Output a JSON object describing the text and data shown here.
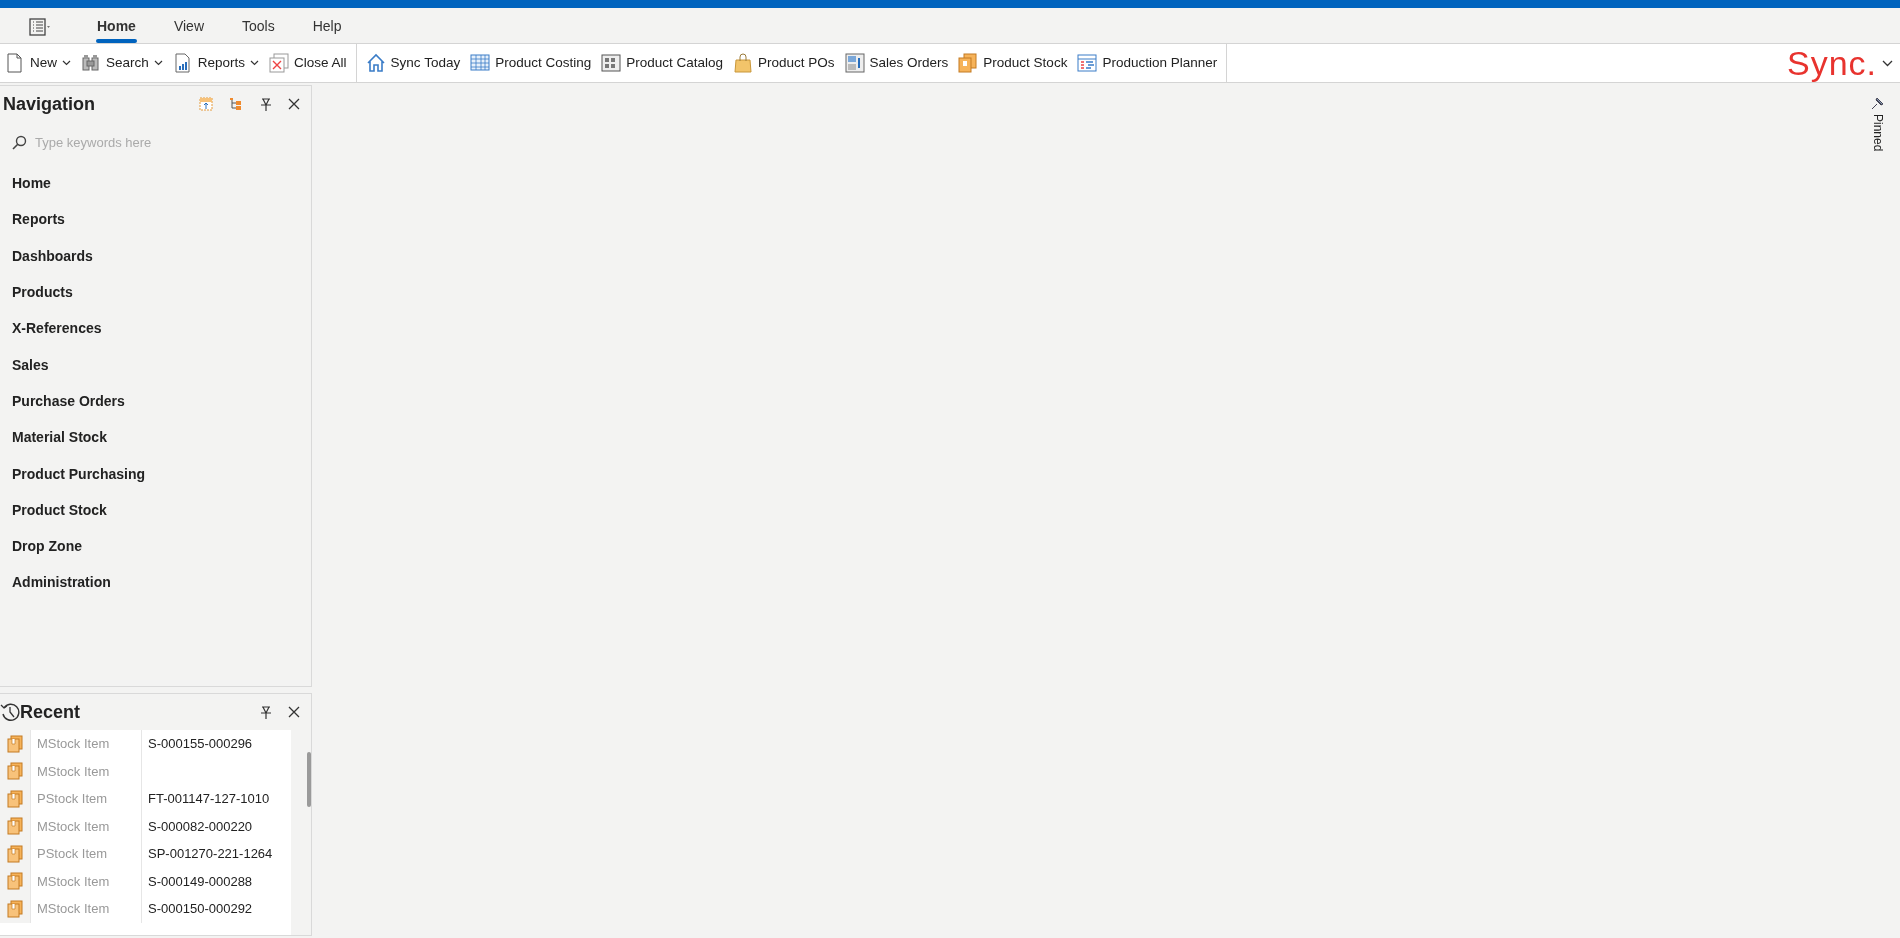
{
  "ribbon_tabs": [
    {
      "label": "Home",
      "selected": true
    },
    {
      "label": "View",
      "selected": false
    },
    {
      "label": "Tools",
      "selected": false
    },
    {
      "label": "Help",
      "selected": false
    }
  ],
  "toolbar": {
    "groups": [
      [
        {
          "label": "New",
          "dropdown": true
        },
        {
          "label": "Search",
          "dropdown": true
        },
        {
          "label": "Reports",
          "dropdown": true
        },
        {
          "label": "Close All",
          "dropdown": false
        }
      ],
      [
        {
          "label": "Sync Today",
          "dropdown": false
        },
        {
          "label": "Product Costing",
          "dropdown": false
        },
        {
          "label": "Product Catalog",
          "dropdown": false
        },
        {
          "label": "Product POs",
          "dropdown": false
        },
        {
          "label": "Sales Orders",
          "dropdown": false
        },
        {
          "label": "Product Stock",
          "dropdown": false
        },
        {
          "label": "Production Planner",
          "dropdown": false
        }
      ]
    ],
    "logo": "Sync."
  },
  "navigation": {
    "title": "Navigation",
    "search": {
      "placeholder": "Type keywords here"
    },
    "items": [
      "Home",
      "Reports",
      "Dashboards",
      "Products",
      "X-References",
      "Sales",
      "Purchase Orders",
      "Material Stock",
      "Product Purchasing",
      "Product Stock",
      "Drop Zone",
      "Administration"
    ]
  },
  "recent": {
    "title": "Recent",
    "rows": [
      {
        "type": "MStock Item",
        "ref": "S-000155-000296"
      },
      {
        "type": "MStock Item",
        "ref": ""
      },
      {
        "type": "PStock Item",
        "ref": "FT-001147-127-1010"
      },
      {
        "type": "MStock Item",
        "ref": "S-000082-000220"
      },
      {
        "type": "PStock Item",
        "ref": "SP-001270-221-1264"
      },
      {
        "type": "MStock Item",
        "ref": "S-000149-000288"
      },
      {
        "type": "MStock Item",
        "ref": "S-000150-000292"
      }
    ]
  },
  "side_tab": {
    "label": "Pinned"
  }
}
